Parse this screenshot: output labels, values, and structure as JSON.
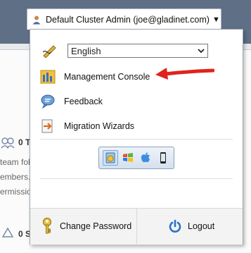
{
  "account": {
    "label": "Default Cluster Admin  (joe@gladinet.com)",
    "caret": "▼"
  },
  "language": {
    "selected": "English"
  },
  "menu": [
    {
      "id": "management-console",
      "label": "Management Console"
    },
    {
      "id": "feedback",
      "label": "Feedback"
    },
    {
      "id": "migration-wizards",
      "label": "Migration Wizards"
    }
  ],
  "platforms": [
    "Windows Explorer",
    "Windows",
    "Mac",
    "Mobile"
  ],
  "footer": {
    "change_password": "Change Password",
    "logout": "Logout"
  },
  "background": {
    "row1_title": "0 T",
    "row2": "team fol",
    "row3": "embers.",
    "row4": "ermissio",
    "row5_title": "0 S"
  },
  "colors": {
    "header": "#5e6f86",
    "arrow": "#e0241b"
  }
}
